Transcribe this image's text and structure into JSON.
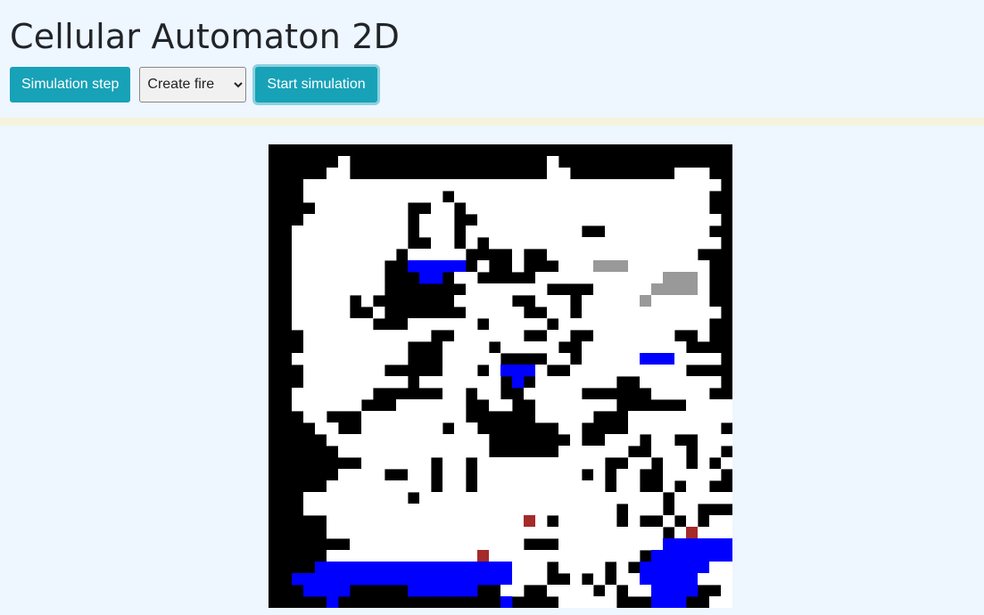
{
  "page": {
    "title": "Cellular Automaton 2D"
  },
  "controls": {
    "step_label": "Simulation step",
    "mode_select": {
      "selected": "Create fire",
      "options": [
        "Create fire"
      ]
    },
    "start_label": "Start simulation"
  },
  "colors": {
    "background": "#eef6ff",
    "accent": "#17a2b8",
    "empty_cell": "#000000",
    "tree_cell": "#ffffff",
    "water_cell": "#0000ff",
    "fire_cell": "#a52a2a",
    "smoke_cell": "#999999"
  },
  "grid": {
    "cols": 40,
    "rows": 40,
    "legend": "#=empty(black) .=tree(white) W=water(blue) F=fire(red) S=smoke(gray)",
    "rows_data": [
      "########################################",
      "######.#################.###############",
      "#####..#################..#########...##",
      "###....................................#",
      "###............#......................##",
      "####........##..#.....................##",
      "###.........#...##.....................#",
      "##..........#...#..........##.........##",
      "##..........##..#.#....................#",
      "##.........#.....####.##.............###",
      "##........##WWWWW#.##.###...SSS.......##",
      "##........###WW#..#####...........SSS.#",
      "##........#######.......####.....SSSS.##",
      "##.....#.#######.....##...#.....S.....##",
      "##.....##.#######.....##..#............#",
      "##.......###......#.....#.............##",
      "###...........##......##..##.......##.##",
      "###.........###....#.....##.........###",
      "##..........###.....####..#.....WWW....#",
      "###.......#####...#.WWW.##..........####",
      "###.........#.......#W#.......##.......#",
      "##.......######..#..##.....######.....##",
      "##......###......##..##.......######....#",
      "###..###.........######.....###.........#",
      "####..##.......#..#######..####........##",
      "#####..............#######.##...#..##...#",
      "######.............######......##...#..##",
      "########......#..#...........##..#..#.#.#",
      "######....##..#..#.........#.#..##.....##",
      "#####.........#..#...........#..##.#..###",
      "###.........#.....................#.....#",
      "###...........................#...#..####",
      "#####.................F.#.....#.##.#.#..#",
      "#####.............................#.F...#",
      "#######...............###.........WWWWWW##",
      "#####.............F.............#WWWWWWW#",
      "####WWWWWWWWWWWWWWWWW...#....#.#WWWWWW...#",
      "##WWWWWWWWWWWWWWWWWWW...##.#.#..WWWWW...##",
      "###WWWW#####WWWWWW##..##....#.#..WWWW##..",
      "#####W##############W####.....###WWW##..#"
    ]
  }
}
